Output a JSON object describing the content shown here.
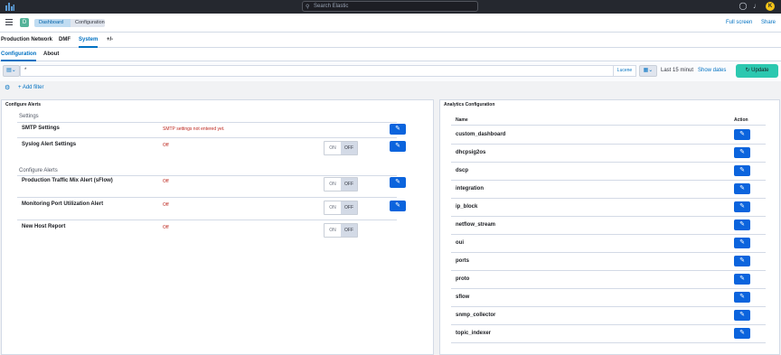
{
  "header": {
    "search_placeholder": "Search Elastic",
    "avatar_initial": "K"
  },
  "breadcrumbs": {
    "items": [
      "Dashboard",
      "Configuration"
    ],
    "full_screen": "Full screen",
    "share": "Share"
  },
  "nav": {
    "tabs": [
      "Production Network",
      "DMF",
      "System",
      "+/-"
    ],
    "active": "System"
  },
  "subnav": {
    "tabs": [
      "Configuration",
      "About"
    ],
    "active": "Configuration"
  },
  "querybar": {
    "query": "*",
    "language": "Lucene",
    "date_range": "Last 15 minut",
    "show_dates": "Show dates",
    "update_label": "Update",
    "add_filter": "+ Add filter"
  },
  "configure_alerts": {
    "title": "Configure Alerts",
    "settings_label": "Settings",
    "alerts_label": "Configure Alerts",
    "settings": [
      {
        "label": "SMTP Settings",
        "status": "SMTP settings not entered yet.",
        "toggle": false,
        "edit": true
      },
      {
        "label": "Syslog Alert Settings",
        "status": "Off",
        "toggle": true,
        "edit": true
      }
    ],
    "alerts": [
      {
        "label": "Production Traffic Mix Alert (sFlow)",
        "status": "Off",
        "toggle": true,
        "edit": true
      },
      {
        "label": "Monitoring Port Utilization Alert",
        "status": "Off",
        "toggle": true,
        "edit": true
      },
      {
        "label": "New Host Report",
        "status": "Off",
        "toggle": true,
        "edit": false
      }
    ],
    "toggle_on": "ON",
    "toggle_off": "OFF"
  },
  "analytics": {
    "title": "Analytics Configuration",
    "col_name": "Name",
    "col_action": "Action",
    "rows": [
      "custom_dashboard",
      "dhcpsig2os",
      "dscp",
      "integration",
      "ip_block",
      "netflow_stream",
      "oui",
      "ports",
      "proto",
      "sflow",
      "snmp_collector",
      "topic_indexer"
    ]
  }
}
